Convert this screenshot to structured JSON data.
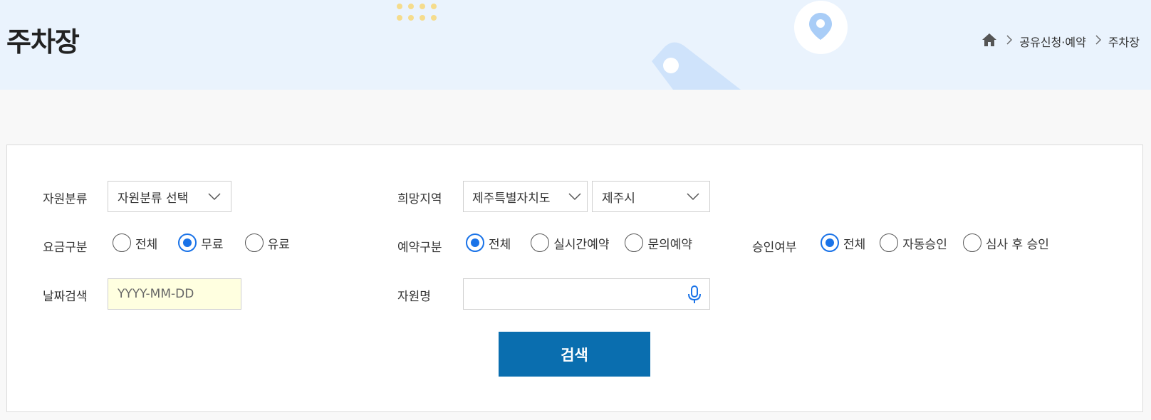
{
  "header": {
    "title": "주차장",
    "breadcrumb": {
      "home_icon": "home-icon",
      "items": [
        "공유신청·예약",
        "주차장"
      ]
    }
  },
  "form": {
    "resource_category": {
      "label": "자원분류",
      "selected": "자원분류 선택"
    },
    "region": {
      "label": "희망지역",
      "province": "제주특별자치도",
      "city": "제주시"
    },
    "fee": {
      "label": "요금구분",
      "options": [
        "전체",
        "무료",
        "유료"
      ],
      "selected": "무료"
    },
    "reservation_type": {
      "label": "예약구분",
      "options": [
        "전체",
        "실시간예약",
        "문의예약"
      ],
      "selected": "전체"
    },
    "approval": {
      "label": "승인여부",
      "options": [
        "전체",
        "자동승인",
        "심사 후 승인"
      ],
      "selected": "전체"
    },
    "date": {
      "label": "날짜검색",
      "placeholder": "YYYY-MM-DD"
    },
    "resource_name": {
      "label": "자원명",
      "value": "",
      "mic_icon": "microphone-icon"
    },
    "search_button": "검색"
  },
  "colors": {
    "banner_bg": "#eaf3fd",
    "accent": "#1a73e8",
    "button_bg": "#0a6eaf",
    "date_bg": "#ffffe0"
  }
}
